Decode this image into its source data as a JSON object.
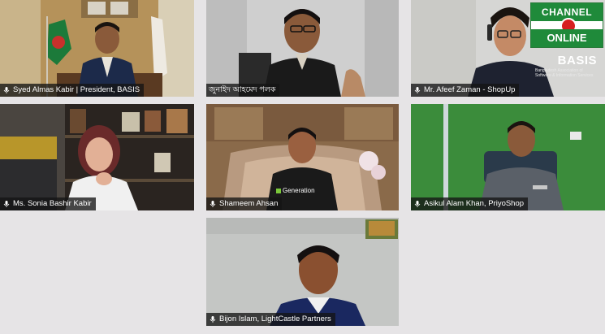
{
  "participants": [
    {
      "name": "Syed Almas Kabir | President, BASIS"
    },
    {
      "name": "জুনাইদ আহমেদ পলক"
    },
    {
      "name": "Mr. Afeef Zaman - ShopUp"
    },
    {
      "name": "Ms. Sonia Bashir Kabir"
    },
    {
      "name": "Shameem Ahsan"
    },
    {
      "name": "Asikul Alam Khan, PriyoShop"
    },
    {
      "name": "Bijon Islam, LightCastle Partners"
    }
  ],
  "overlays": {
    "channel_top": "CHANNEL",
    "channel_bottom": "ONLINE",
    "basis": "BASIS",
    "basis_sub": "Bangladesh Association of Software & Information Services",
    "shirt_text": "Generation"
  },
  "colors": {
    "background": "#e6e4e6",
    "nameplate": "#141414",
    "channel_green": "#1f8a3a",
    "channel_red": "#d62020"
  },
  "icons": {
    "mic": "microphone-icon"
  }
}
